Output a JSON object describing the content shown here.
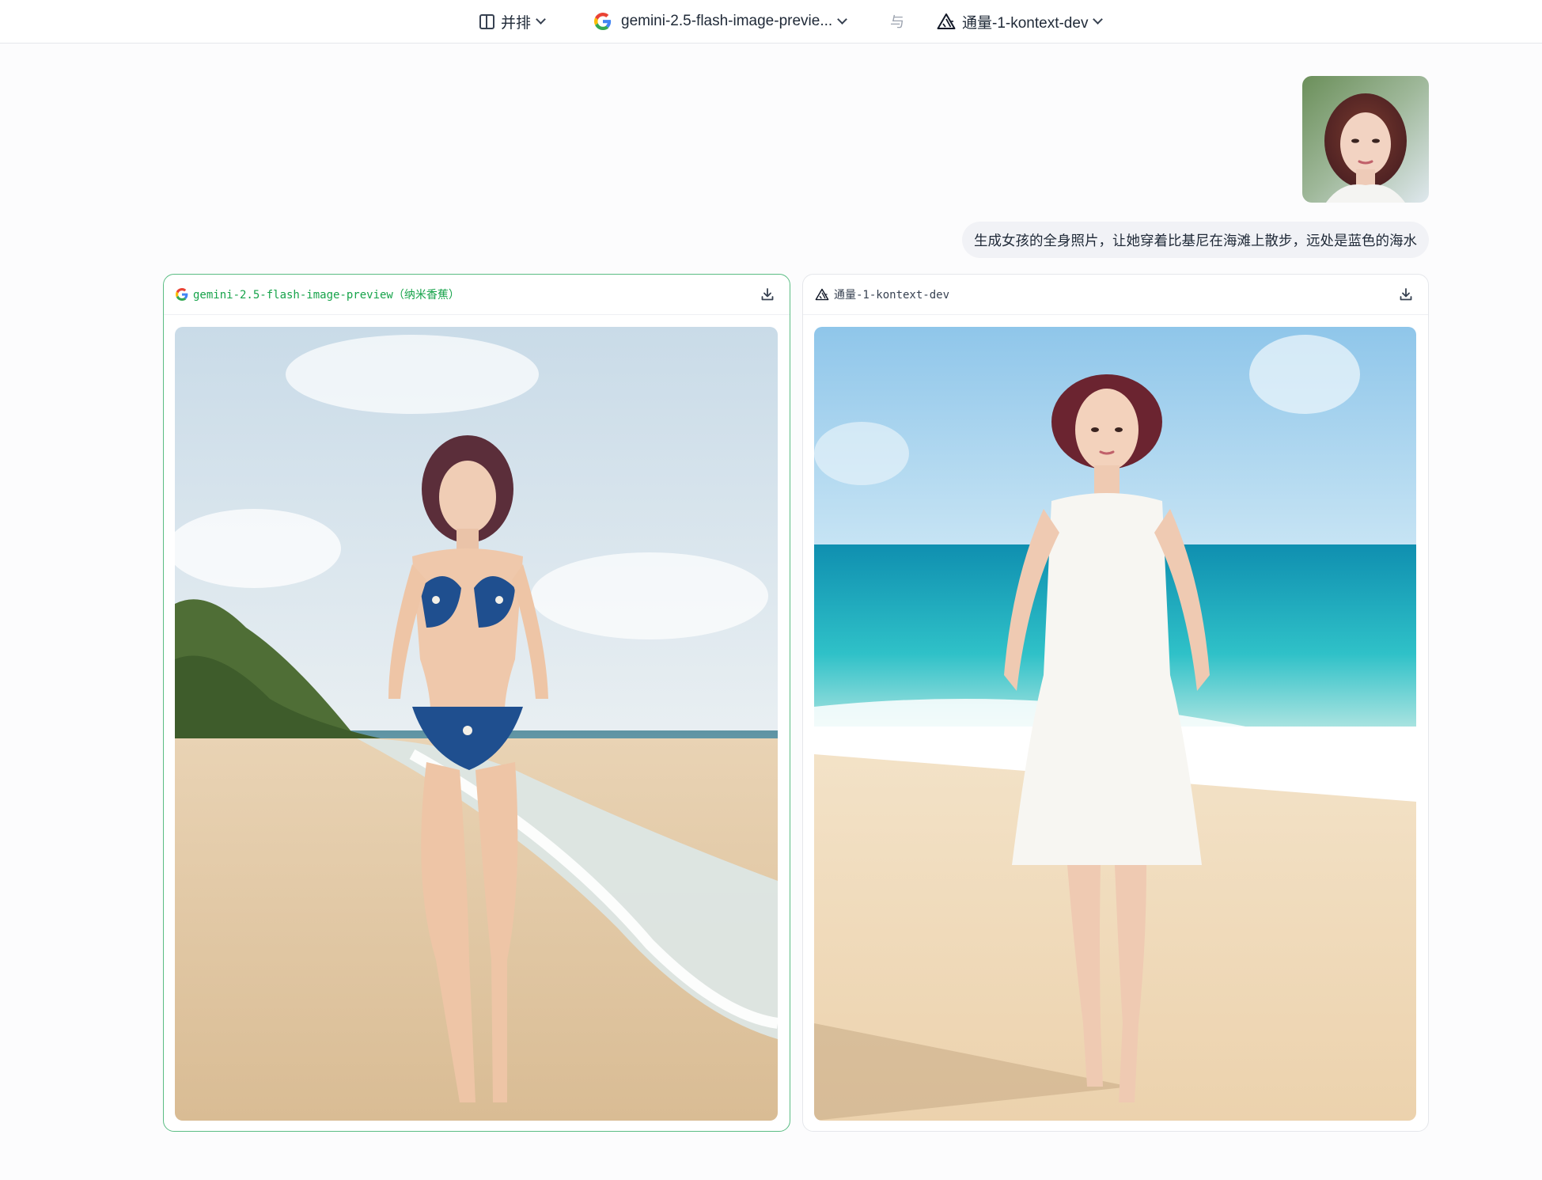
{
  "topbar": {
    "layout_label": "并排",
    "model_a_label": "gemini-2.5-flash-image-previe...",
    "vs_label": "与",
    "model_b_label": "通量-1-kontext-dev"
  },
  "chat": {
    "prompt": "生成女孩的全身照片，让她穿着比基尼在海滩上散步，远处是蓝色的海水"
  },
  "results": [
    {
      "model": "gemini-2.5-flash-image-preview（纳米香蕉）",
      "icon": "google-logo-icon",
      "selected": true
    },
    {
      "model": "通量-1-kontext-dev",
      "icon": "flux-triangle-icon",
      "selected": false
    }
  ],
  "colors": {
    "selected_border": "#5bbd84",
    "selected_text": "#16a34a",
    "prompt_bubble_bg": "#f1f2f6"
  }
}
